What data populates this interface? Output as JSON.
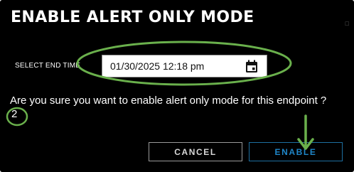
{
  "dialog": {
    "title": "ENABLE ALERT ONLY MODE",
    "end_time": {
      "label": "SELECT END TIME",
      "value": "01/30/2025 12:18 pm",
      "icon": "calendar-icon"
    },
    "question": "Are you sure you want to enable alert only mode for this endpoint ?",
    "buttons": {
      "cancel_label": "CANCEL",
      "enable_label": "ENABLE"
    }
  },
  "annotations": {
    "step_number": "2",
    "highlight_color": "#6ab04c"
  },
  "colors": {
    "dialog_background": "#000000",
    "enable_accent": "#1f86c8",
    "cancel_border": "#9a9a9a"
  }
}
